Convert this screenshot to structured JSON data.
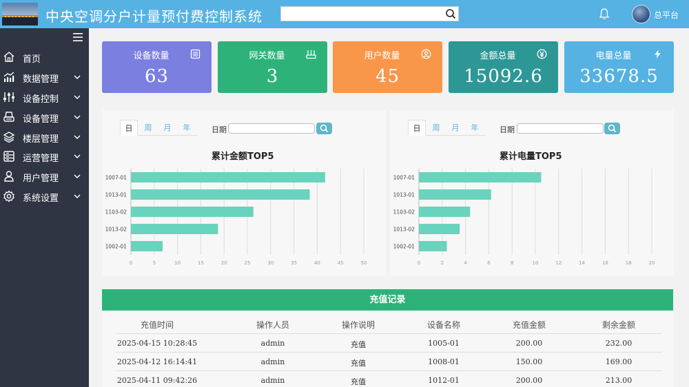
{
  "header": {
    "title": "中央空调分户计量预付费控制系统",
    "search_placeholder": "",
    "platform_label": "总平台"
  },
  "sidebar": {
    "items": [
      {
        "label": "首页",
        "icon": "home-icon",
        "has_submenu": false
      },
      {
        "label": "数据管理",
        "icon": "chart-icon",
        "has_submenu": true
      },
      {
        "label": "设备控制",
        "icon": "sliders-icon",
        "has_submenu": true
      },
      {
        "label": "设备管理",
        "icon": "printer-icon",
        "has_submenu": true
      },
      {
        "label": "楼层管理",
        "icon": "layers-icon",
        "has_submenu": true
      },
      {
        "label": "运营管理",
        "icon": "server-icon",
        "has_submenu": true
      },
      {
        "label": "用户管理",
        "icon": "user-icon",
        "has_submenu": true
      },
      {
        "label": "系统设置",
        "icon": "gear-icon",
        "has_submenu": true
      }
    ]
  },
  "stats": [
    {
      "label": "设备数量",
      "value": "63",
      "icon": "list-icon",
      "color": "#7b7fe0"
    },
    {
      "label": "网关数量",
      "value": "3",
      "icon": "gateway-icon",
      "color": "#2db37a"
    },
    {
      "label": "用户数量",
      "value": "45",
      "icon": "user-circle-icon",
      "color": "#f8964a"
    },
    {
      "label": "金额总量",
      "value": "15092.6",
      "icon": "yen-icon",
      "color": "#2d9796"
    },
    {
      "label": "电量总量",
      "value": "33678.5",
      "icon": "bolt-icon",
      "color": "#55b2e3"
    }
  ],
  "tabs": [
    "日",
    "周",
    "月",
    "年"
  ],
  "date_label": "日期",
  "chart_data": [
    {
      "type": "bar",
      "orientation": "horizontal",
      "title": "累计金额TOP5",
      "categories": [
        "1007-01",
        "1013-01",
        "1103-02",
        "1013-02",
        "1002-01"
      ],
      "values": [
        41.7,
        38.4,
        26.3,
        18.7,
        6.8
      ],
      "xlim": [
        0,
        50
      ],
      "xticks": [
        "0",
        "5",
        "10",
        "15",
        "20",
        "25",
        "30",
        "35",
        "40",
        "45",
        "50"
      ],
      "color": "#6ad3bd",
      "grid": true
    },
    {
      "type": "bar",
      "orientation": "horizontal",
      "title": "累计电量TOP5",
      "categories": [
        "1007-01",
        "1013-01",
        "1103-02",
        "1013-02",
        "1002-01"
      ],
      "values": [
        10.5,
        6.2,
        4.4,
        3.5,
        2.4
      ],
      "xlim": [
        0,
        20
      ],
      "xticks": [
        "0",
        "2",
        "4",
        "6",
        "8",
        "10",
        "12",
        "14",
        "16",
        "18",
        "20"
      ],
      "color": "#6ad3bd",
      "grid": true
    }
  ],
  "records": {
    "title": "充值记录",
    "columns": [
      "充值时间",
      "操作人员",
      "操作说明",
      "设备名称",
      "充值金额",
      "剩余金额"
    ],
    "rows": [
      [
        "2025-04-15 10:28:45",
        "admin",
        "充值",
        "1005-01",
        "200.00",
        "232.00"
      ],
      [
        "2025-04-12 16:14:41",
        "admin",
        "充值",
        "1008-01",
        "150.00",
        "169.00"
      ],
      [
        "2025-04-11 09:42:26",
        "admin",
        "充值",
        "1012-01",
        "200.00",
        "213.00"
      ]
    ]
  }
}
